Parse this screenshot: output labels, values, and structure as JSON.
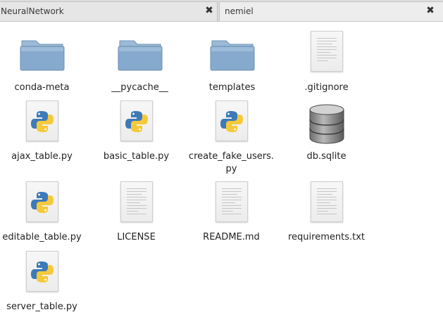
{
  "tabs": [
    {
      "label": "NeuralNetwork",
      "close": "✖"
    },
    {
      "label": "nemiel",
      "close": "✖"
    }
  ],
  "items": [
    {
      "label": "conda-meta",
      "type": "folder"
    },
    {
      "label": "__pycache__",
      "type": "folder"
    },
    {
      "label": "templates",
      "type": "folder"
    },
    {
      "label": ".gitignore",
      "type": "text"
    },
    {
      "label": "ajax_table.py",
      "type": "python"
    },
    {
      "label": "basic_table.py",
      "type": "python"
    },
    {
      "label": "create_fake_users.\npy",
      "type": "python"
    },
    {
      "label": "db.sqlite",
      "type": "database"
    },
    {
      "label": "editable_table.py",
      "type": "python"
    },
    {
      "label": "LICENSE",
      "type": "text"
    },
    {
      "label": "README.md",
      "type": "text"
    },
    {
      "label": "requirements.txt",
      "type": "text"
    },
    {
      "label": "server_table.py",
      "type": "python"
    }
  ],
  "colors": {
    "folder_top": "#a9c4dc",
    "folder_body": "#7fa3c6",
    "python_blue": "#3d7ab8",
    "python_yellow": "#f5c93a"
  }
}
